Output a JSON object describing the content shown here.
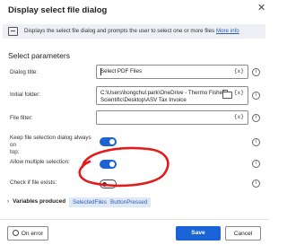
{
  "dialog": {
    "title": "Display select file dialog",
    "close_icon": "close-icon"
  },
  "banner": {
    "text": "Displays the select file dialog and prompts the user to select one or more files",
    "link": "More info",
    "icon": "dialog-icon"
  },
  "section": {
    "title": "Select parameters"
  },
  "fields": {
    "dialog_title": {
      "label": "Dialog title:",
      "value": "Select PDF Files",
      "var_button": "{x}"
    },
    "initial_folder": {
      "label": "Initial folder:",
      "value": "C:\\Users\\hongchul.park\\OneDrive - Thermo Fisher\nScientific\\Desktop\\ASV Tax Invoice",
      "var_button": "{x}",
      "folder_icon": "folder-icon"
    },
    "file_filter": {
      "label": "File filter:",
      "value": "",
      "var_button": "{x}"
    }
  },
  "toggles": {
    "keep_on_top": {
      "label": "Keep file selection dialog always on\ntop:",
      "state": "on"
    },
    "allow_multiple": {
      "label": "Allow multiple selection:",
      "state": "on"
    },
    "check_exists": {
      "label": "Check if file exists:",
      "state": "off"
    }
  },
  "variables": {
    "label": "Variables produced",
    "chevron": "›",
    "items": [
      "SelectedFiles",
      "ButtonPressed"
    ]
  },
  "footer": {
    "on_error": "On error",
    "save": "Save",
    "cancel": "Cancel"
  },
  "colors": {
    "accent": "#1a63d6",
    "annotation": "#e21b1b",
    "link": "#2b5eb8"
  }
}
